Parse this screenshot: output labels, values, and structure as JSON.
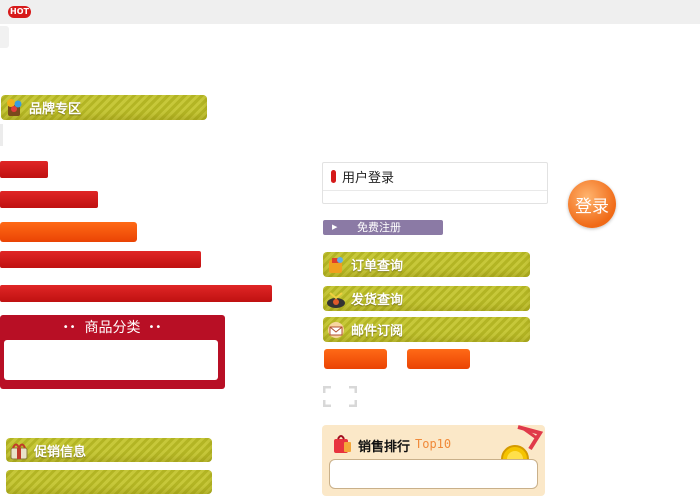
{
  "top": {
    "hot_badge": "HOT"
  },
  "brand_section": {
    "title": "品牌专区",
    "icon": "brand-bag-icon"
  },
  "category": {
    "title": "商品分类",
    "dots": "••"
  },
  "login": {
    "title": "用户登录",
    "login_button": "登录",
    "register_button": "免费注册"
  },
  "links": {
    "order_query": "订单查询",
    "shipping_query": "发货查询",
    "mail_subscribe": "邮件订阅"
  },
  "promo": {
    "title": "促销信息"
  },
  "ranking": {
    "title": "销售排行",
    "subtitle": "Top10"
  },
  "colors": {
    "red": "#d71a1a",
    "orange": "#ff5a10",
    "olive": "#b8ba2a",
    "purple": "#8b7aa5",
    "category_red": "#b80f25"
  }
}
